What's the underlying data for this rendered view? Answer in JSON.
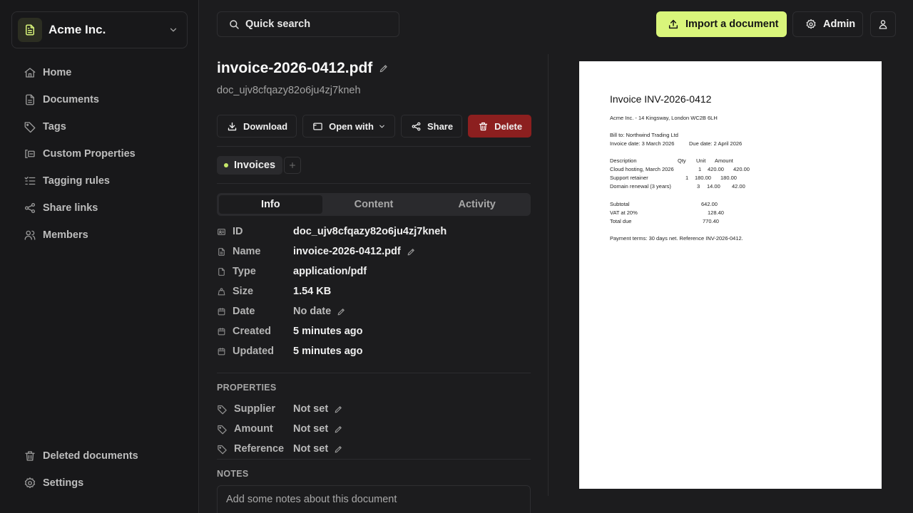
{
  "sidebar": {
    "org_name": "Acme Inc.",
    "items": [
      {
        "label": "Home",
        "icon": "home-icon"
      },
      {
        "label": "Documents",
        "icon": "document-icon"
      },
      {
        "label": "Tags",
        "icon": "tag-icon"
      },
      {
        "label": "Custom Properties",
        "icon": "properties-icon"
      },
      {
        "label": "Tagging rules",
        "icon": "list-check-icon"
      },
      {
        "label": "Share links",
        "icon": "share-icon"
      },
      {
        "label": "Members",
        "icon": "users-icon"
      }
    ],
    "bottom_items": [
      {
        "label": "Deleted documents",
        "icon": "trash-icon"
      },
      {
        "label": "Settings",
        "icon": "gear-icon"
      }
    ]
  },
  "topbar": {
    "search_label": "Quick search",
    "import_label": "Import a document",
    "admin_label": "Admin"
  },
  "document": {
    "title": "invoice-2026-0412.pdf",
    "id": "doc_ujv8cfqazy82o6ju4zj7kneh",
    "actions": {
      "download": "Download",
      "open_with": "Open with",
      "share": "Share",
      "delete": "Delete"
    },
    "tags": [
      {
        "label": "Invoices",
        "color": "#c6e86a"
      }
    ],
    "tabs": [
      "Info",
      "Content",
      "Activity"
    ],
    "active_tab": "Info",
    "info": [
      {
        "key": "ID",
        "value": "doc_ujv8cfqazy82o6ju4zj7kneh"
      },
      {
        "key": "Name",
        "value": "invoice-2026-0412.pdf"
      },
      {
        "key": "Type",
        "value": "application/pdf"
      },
      {
        "key": "Size",
        "value": "1.54 KB"
      },
      {
        "key": "Date",
        "value": "No date"
      },
      {
        "key": "Created",
        "value": "5 minutes ago"
      },
      {
        "key": "Updated",
        "value": "5 minutes ago"
      }
    ],
    "properties_label": "PROPERTIES",
    "properties": [
      {
        "key": "Supplier",
        "value": "Not set"
      },
      {
        "key": "Amount",
        "value": "Not set"
      },
      {
        "key": "Reference",
        "value": "Not set"
      }
    ],
    "notes_label": "NOTES",
    "notes_placeholder": "Add some notes about this document"
  },
  "preview": {
    "title": "Invoice INV-2026-0412",
    "from": "Acme Inc.  -  14 Kingsway, London WC2B 6LH",
    "bill_to": "Bill to: Northwind Trading Ltd",
    "invoice_date": "Invoice date: 3 March 2026",
    "due_date": "Due date: 2 April 2026",
    "headers": {
      "description": "Description",
      "qty": "Qty",
      "unit": "Unit",
      "amount": "Amount"
    },
    "lines": [
      {
        "description": "Cloud hosting, March 2026",
        "qty": "1",
        "unit": "420.00",
        "amount": "420.00"
      },
      {
        "description": "Support retainer",
        "qty": "1",
        "unit": "180.00",
        "amount": "180.00"
      },
      {
        "description": "Domain renewal (3 years)",
        "qty": "3",
        "unit": "14.00",
        "amount": "42.00"
      }
    ],
    "subtotal_label": "Subtotal",
    "subtotal": "642.00",
    "vat_label": "VAT at 20%",
    "vat": "128.40",
    "total_label": "Total due",
    "total": "770.40",
    "terms": "Payment terms: 30 days net. Reference INV-2026-0412."
  },
  "colors": {
    "accent": "#d9f57b",
    "danger": "#8c1f1f",
    "background": "#1c1c1e"
  }
}
